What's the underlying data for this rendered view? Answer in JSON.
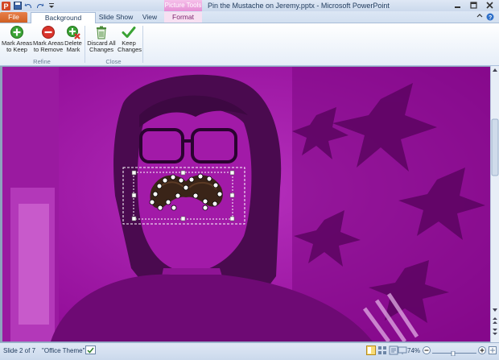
{
  "window": {
    "title": "Pin the Mustache on Jeremy.pptx - Microsoft PowerPoint",
    "context_group": "Picture Tools"
  },
  "tabs": {
    "file": "File",
    "background_removal": "Background Removal",
    "slide_show": "Slide Show",
    "view": "View",
    "format": "Format"
  },
  "ribbon": {
    "refine": {
      "label": "Refine",
      "mark_keep": [
        "Mark Areas",
        "to Keep"
      ],
      "mark_remove": [
        "Mark Areas",
        "to Remove"
      ],
      "delete_mark": [
        "Delete",
        "Mark"
      ]
    },
    "close": {
      "label": "Close",
      "discard": [
        "Discard All",
        "Changes"
      ],
      "keep": [
        "Keep",
        "Changes"
      ]
    }
  },
  "status": {
    "slide": "Slide 2 of 7",
    "theme": "\"Office Theme\"",
    "zoom": "74%"
  },
  "colors": {
    "removal_overlay": "#b010b6",
    "file_tab": "#d96a30",
    "keep_green": "#3aa335",
    "remove_red": "#d9342b"
  }
}
